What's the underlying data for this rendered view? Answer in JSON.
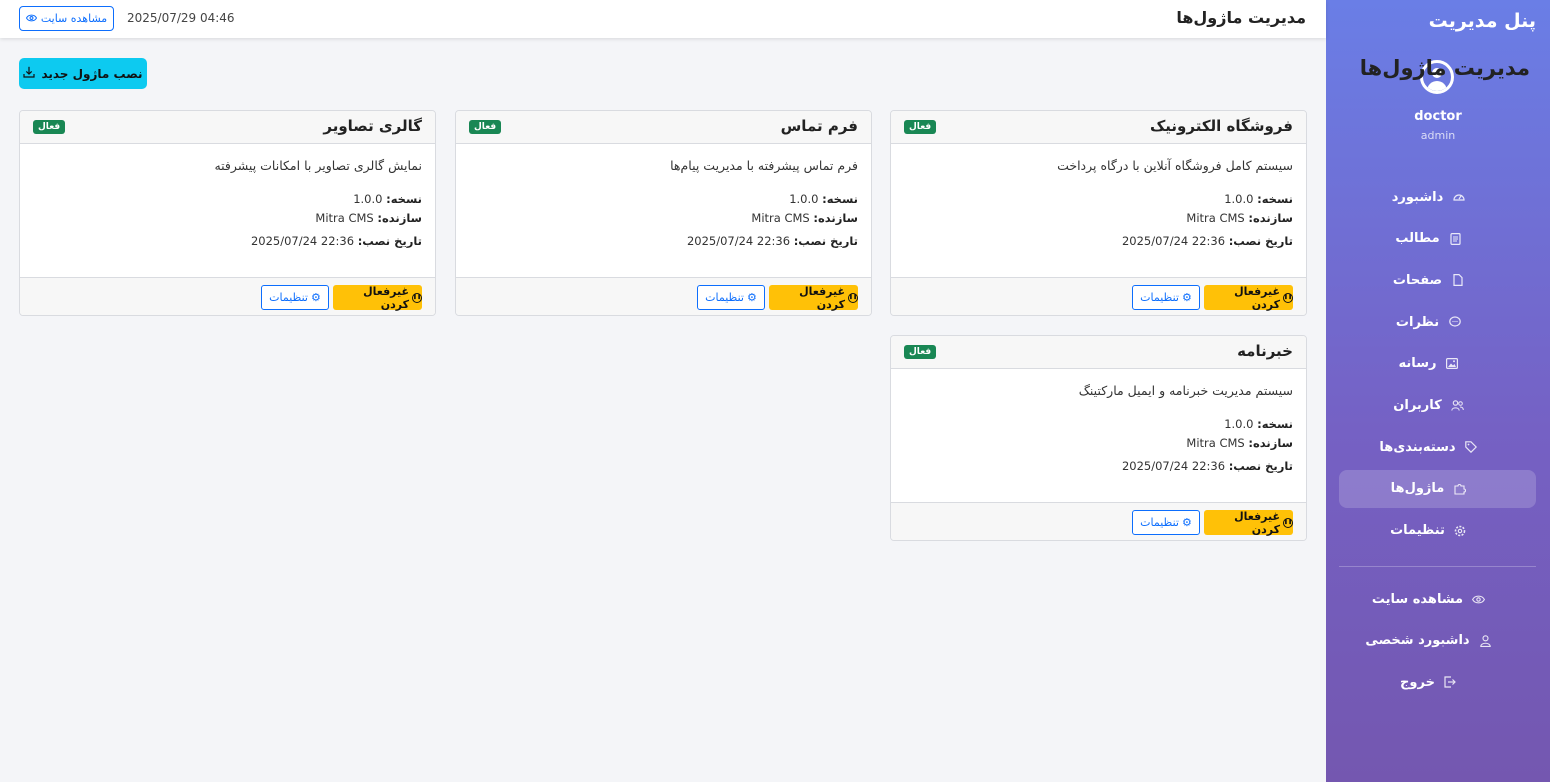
{
  "sidebar": {
    "title": "پنل مدیریت",
    "user": "doctor",
    "role": "admin",
    "items": [
      {
        "label": "داشبورد",
        "icon": "dashboard-icon"
      },
      {
        "label": "مطالب",
        "icon": "document-icon"
      },
      {
        "label": "صفحات",
        "icon": "page-icon"
      },
      {
        "label": "نظرات",
        "icon": "comment-icon"
      },
      {
        "label": "رسانه",
        "icon": "image-icon"
      },
      {
        "label": "کاربران",
        "icon": "users-icon"
      },
      {
        "label": "دسته‌بندی‌ها",
        "icon": "tag-icon"
      },
      {
        "label": "ماژول‌ها",
        "icon": "puzzle-icon",
        "active": true
      },
      {
        "label": "تنظیمات",
        "icon": "gear-icon"
      }
    ],
    "secondary": [
      {
        "label": "مشاهده سایت",
        "icon": "eye-icon"
      },
      {
        "label": "داشبورد شخصی",
        "icon": "person-icon"
      },
      {
        "label": "خروج",
        "icon": "logout-icon"
      }
    ]
  },
  "topbar": {
    "title": "مدیریت ماژول‌ها",
    "datetime": "2025/07/29 04:46",
    "view_site": "مشاهده سایت"
  },
  "main": {
    "title": "مدیریت ماژول‌ها",
    "install_button": "نصب ماژول جدید",
    "version_label": "نسخه:",
    "author_label": "سازنده:",
    "installed_label": "تاریخ نصب:",
    "deactivate_label": "غیرفعال کردن",
    "settings_label": "تنظیمات",
    "modules": [
      {
        "name": "فروشگاه الکترونیک",
        "status": "فعال",
        "description": "سیستم کامل فروشگاه آنلاین با درگاه پرداخت",
        "version": "1.0.0",
        "author": "Mitra CMS",
        "installed": "2025/07/24 22:36"
      },
      {
        "name": "فرم تماس",
        "status": "فعال",
        "description": "فرم تماس پیشرفته با مدیریت پیام‌ها",
        "version": "1.0.0",
        "author": "Mitra CMS",
        "installed": "2025/07/24 22:36"
      },
      {
        "name": "گالری تصاویر",
        "status": "فعال",
        "description": "نمایش گالری تصاویر با امکانات پیشرفته",
        "version": "1.0.0",
        "author": "Mitra CMS",
        "installed": "2025/07/24 22:36"
      },
      {
        "name": "خبرنامه",
        "status": "فعال",
        "description": "سیستم مدیریت خبرنامه و ایمیل مارکتینگ",
        "version": "1.0.0",
        "author": "Mitra CMS",
        "installed": "2025/07/24 22:36"
      }
    ]
  },
  "colors": {
    "sidebar_gradient_top": "#6a7ee6",
    "sidebar_gradient_bottom": "#7457b0",
    "primary": "#0d6efd",
    "info": "#0dcaf0",
    "warning": "#ffc107",
    "success": "#198754"
  }
}
